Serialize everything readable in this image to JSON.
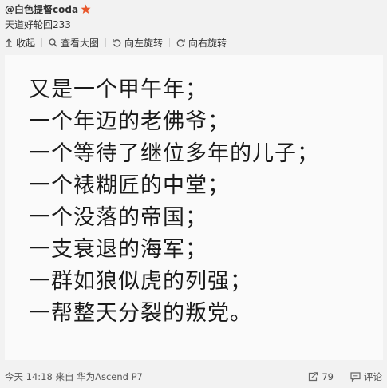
{
  "post": {
    "author": "@白色提督coda",
    "text": "天道好轮回233"
  },
  "toolbar": {
    "collapse": "收起",
    "view_large": "查看大图",
    "rotate_left": "向左旋转",
    "rotate_right": "向右旋转"
  },
  "image_text": {
    "lines": [
      "又是一个甲午年；",
      "一个年迈的老佛爷；",
      "一个等待了继位多年的儿子；",
      "一个裱糊匠的中堂；",
      "一个没落的帝国；",
      "一支衰退的海军；",
      "一群如狼似虎的列强；",
      "一帮整天分裂的叛党。"
    ]
  },
  "footer": {
    "meta": "今天 14:18 来自 华为Ascend P7",
    "repost_count": "79",
    "comment": "评论"
  },
  "colors": {
    "badge": "#e8562a",
    "image_bg": "#fafafa"
  }
}
